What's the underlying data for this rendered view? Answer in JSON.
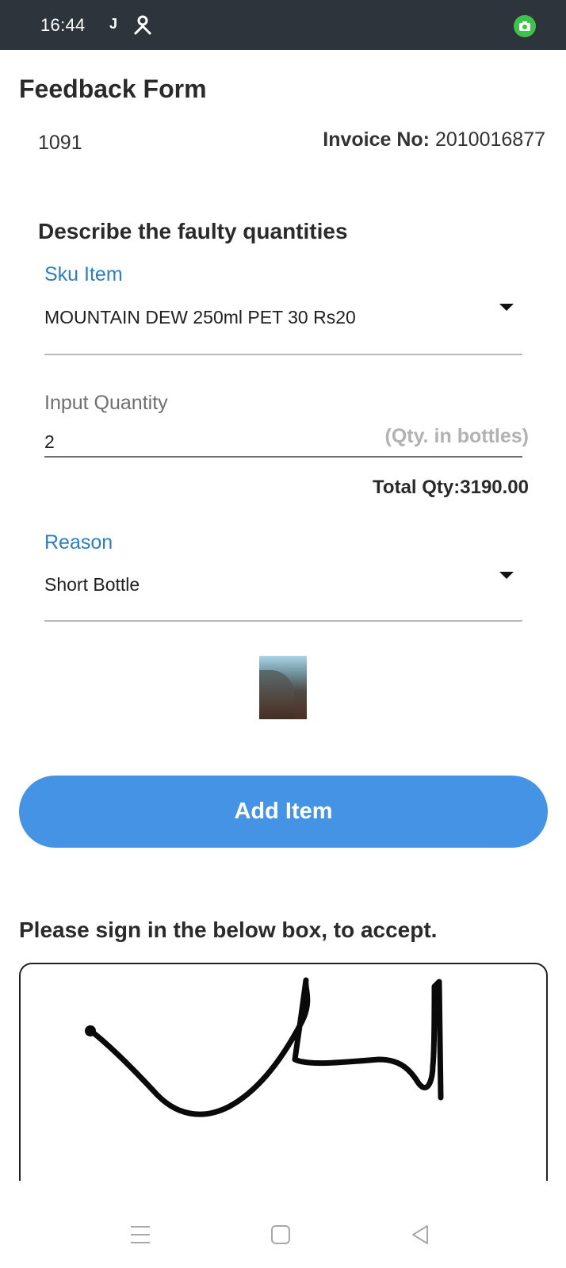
{
  "status_bar": {
    "time": "16:44",
    "j_glyph": "J",
    "icons": [
      "j-icon",
      "person-icon",
      "camera-icon"
    ]
  },
  "form": {
    "title": "Feedback Form",
    "order_id": "1091",
    "invoice_label": "Invoice No:",
    "invoice_value": "2010016877",
    "section_title": "Describe the faulty quantities",
    "sku": {
      "label": "Sku Item",
      "value": "MOUNTAIN DEW 250ml PET 30 Rs20"
    },
    "quantity": {
      "label": "Input Quantity",
      "value": "2",
      "hint": "(Qty. in bottles)"
    },
    "total_qty": "Total Qty:3190.00",
    "reason": {
      "label": "Reason",
      "value": "Short Bottle"
    },
    "add_button_label": "Add Item",
    "sign_prompt": "Please sign in the below box, to accept."
  },
  "colors": {
    "status_bar": "#2e343b",
    "label_blue": "#2b7fc4",
    "button": "#4593e5",
    "hint_gray": "#b2b2b2"
  },
  "nav": {
    "icons": [
      "menu-icon",
      "home-icon",
      "back-icon"
    ]
  }
}
